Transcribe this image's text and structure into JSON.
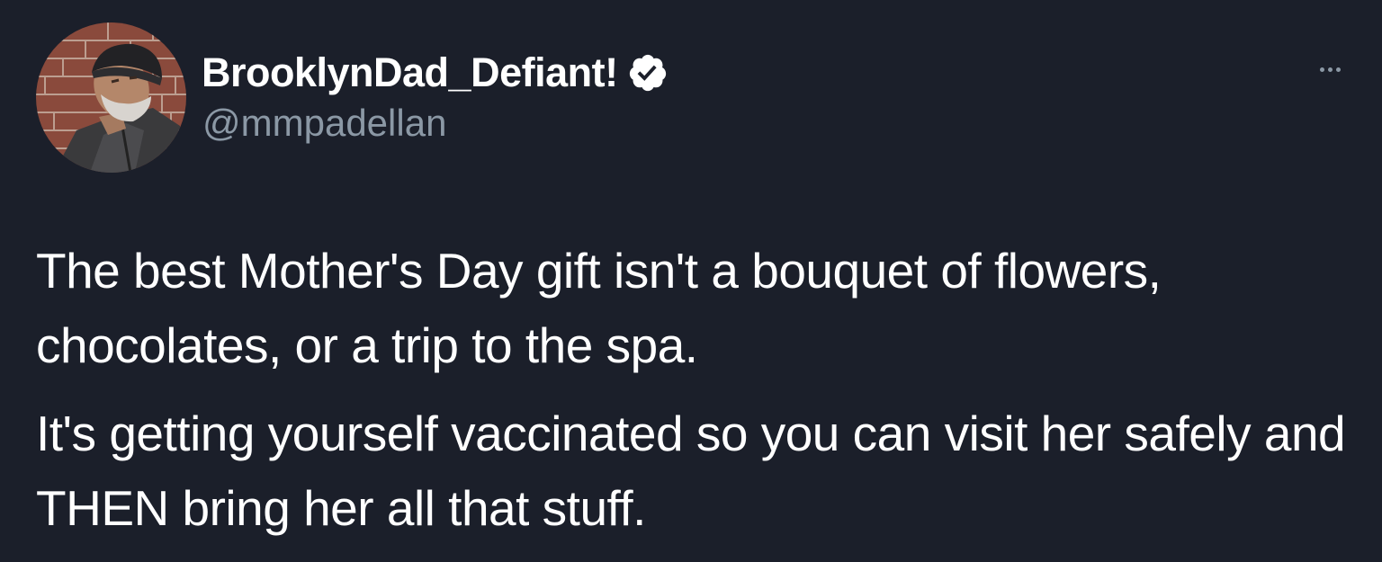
{
  "tweet": {
    "author": {
      "display_name": "BrooklynDad_Defiant!",
      "handle": "@mmpadellan",
      "verified": true,
      "avatar_icon": "profile-photo"
    },
    "more_icon": "more-horizontal-icon",
    "text_paragraphs": [
      "The best Mother's Day gift isn't a bouquet of flowers, chocolates, or a trip to the spa.",
      "It's getting yourself vaccinated so you can visit her safely and THEN bring her all that stuff."
    ]
  },
  "colors": {
    "background": "#1b1f2a",
    "primary_text": "#ffffff",
    "secondary_text": "#8b98a5",
    "verified_badge": "#ffffff"
  }
}
